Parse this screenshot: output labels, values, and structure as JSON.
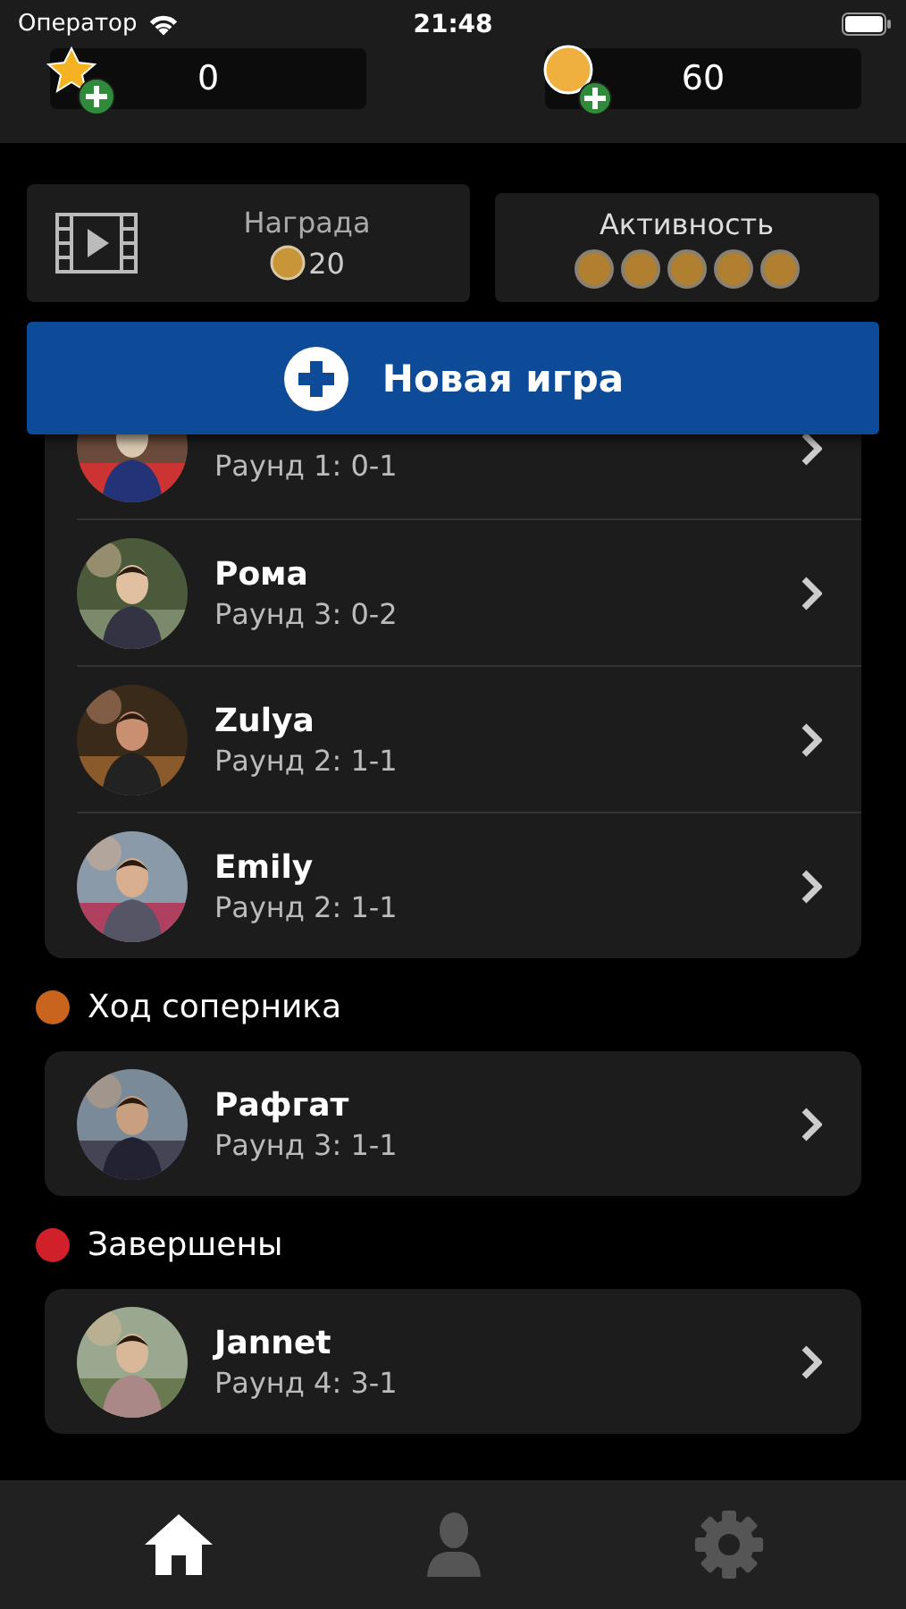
{
  "status_bar": {
    "carrier": "Оператор",
    "time": "21:48"
  },
  "header": {
    "stars": "0",
    "coins": "60"
  },
  "reward": {
    "label": "Награда",
    "amount": "20"
  },
  "activity": {
    "label": "Активность",
    "coins": [
      {
        "filled": true
      },
      {
        "filled": true
      },
      {
        "filled": true
      },
      {
        "filled": true
      },
      {
        "filled": true
      }
    ]
  },
  "new_game_button": "Новая игра",
  "sections": [
    {
      "games": [
        {
          "round": "Раунд 1: 0-1"
        },
        {
          "name": "Рома",
          "round": "Раунд 3: 0-2"
        },
        {
          "name": "Zulya",
          "round": "Раунд 2: 1-1"
        },
        {
          "name": "Emily",
          "round": "Раунд 2: 1-1"
        }
      ]
    },
    {
      "title": "Ход соперника",
      "color": "#c8641e",
      "games": [
        {
          "name": "Рафгат",
          "round": "Раунд 3: 1-1"
        }
      ]
    },
    {
      "title": "Завершены",
      "color": "#d0202a",
      "games": [
        {
          "name": "Jannet",
          "round": "Раунд 4: 3-1"
        }
      ]
    }
  ],
  "tab_bar": [
    {
      "kind": "home",
      "selected": true
    },
    {
      "kind": "profile",
      "selected": false
    },
    {
      "kind": "settings",
      "selected": false
    }
  ]
}
